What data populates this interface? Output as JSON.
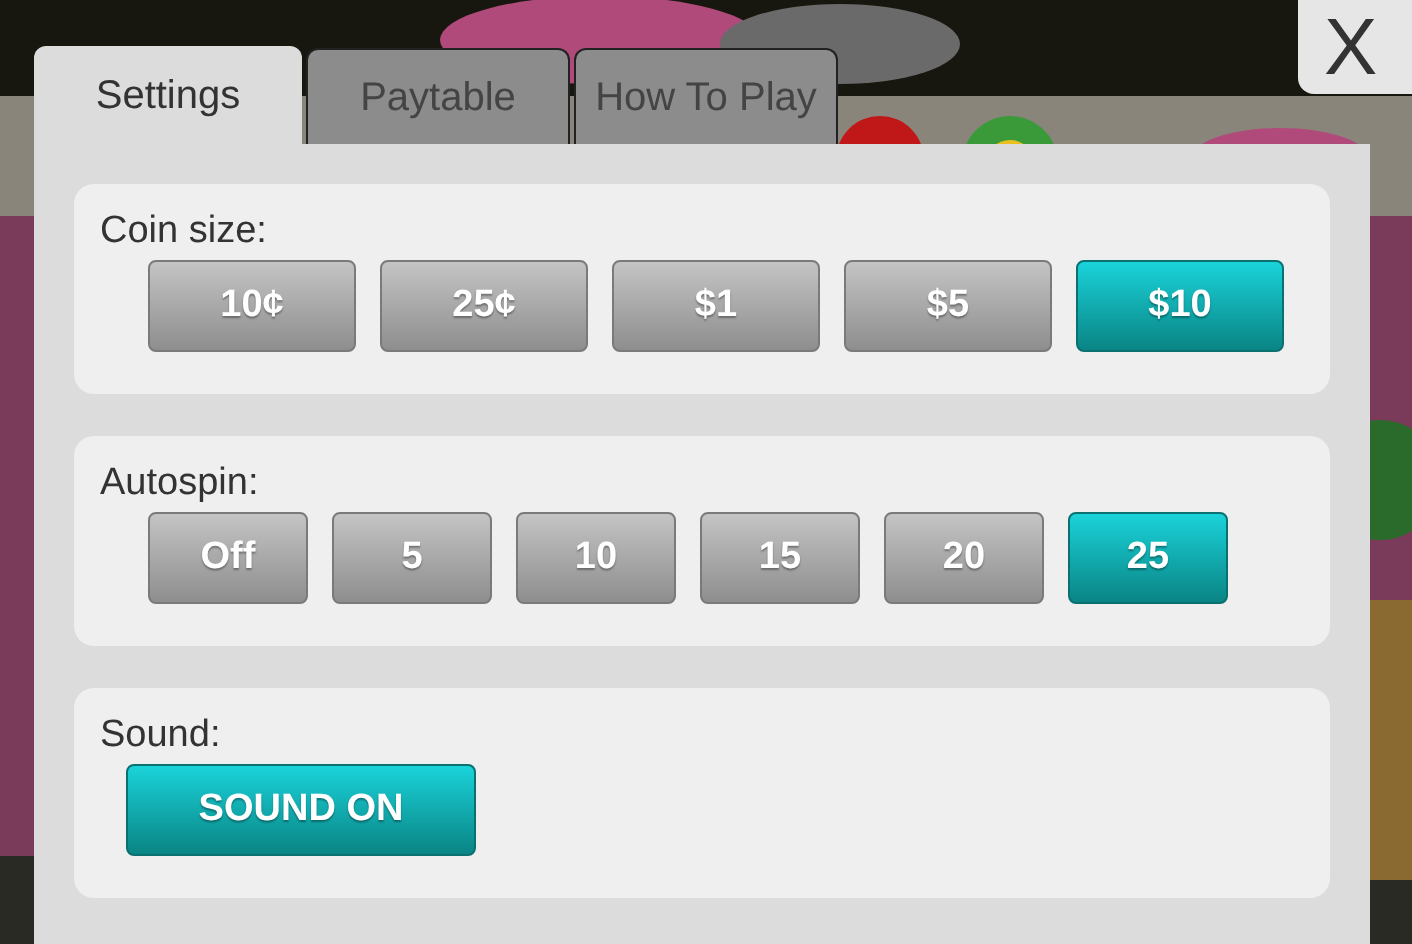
{
  "close_button": {
    "label": "X"
  },
  "tabs": [
    {
      "label": "Settings",
      "selected": true
    },
    {
      "label": "Paytable",
      "selected": false
    },
    {
      "label": "How To Play",
      "selected": false
    }
  ],
  "sections": [
    {
      "label": "Coin size:",
      "kind": "wide",
      "options": [
        {
          "label": "10¢",
          "selected": false
        },
        {
          "label": "25¢",
          "selected": false
        },
        {
          "label": "$1",
          "selected": false
        },
        {
          "label": "$5",
          "selected": false
        },
        {
          "label": "$10",
          "selected": true
        }
      ]
    },
    {
      "label": "Autospin:",
      "kind": "narrow",
      "options": [
        {
          "label": "Off",
          "selected": false
        },
        {
          "label": "5",
          "selected": false
        },
        {
          "label": "10",
          "selected": false
        },
        {
          "label": "15",
          "selected": false
        },
        {
          "label": "20",
          "selected": false
        },
        {
          "label": "25",
          "selected": true
        }
      ]
    },
    {
      "label": "Sound:",
      "kind": "toggle",
      "options": [
        {
          "label": "SOUND ON",
          "selected": true
        }
      ]
    }
  ]
}
